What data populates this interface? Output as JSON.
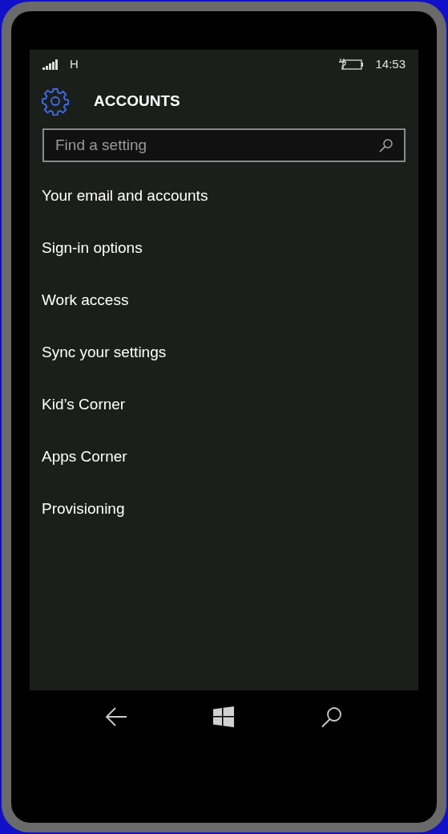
{
  "status_bar": {
    "network": "H",
    "time": "14:53"
  },
  "header": {
    "title": "ACCOUNTS"
  },
  "search": {
    "placeholder": "Find a setting"
  },
  "items": [
    {
      "label": "Your email and accounts"
    },
    {
      "label": "Sign-in options"
    },
    {
      "label": "Work access"
    },
    {
      "label": "Sync your settings"
    },
    {
      "label": "Kid’s Corner"
    },
    {
      "label": "Apps Corner"
    },
    {
      "label": "Provisioning"
    }
  ]
}
